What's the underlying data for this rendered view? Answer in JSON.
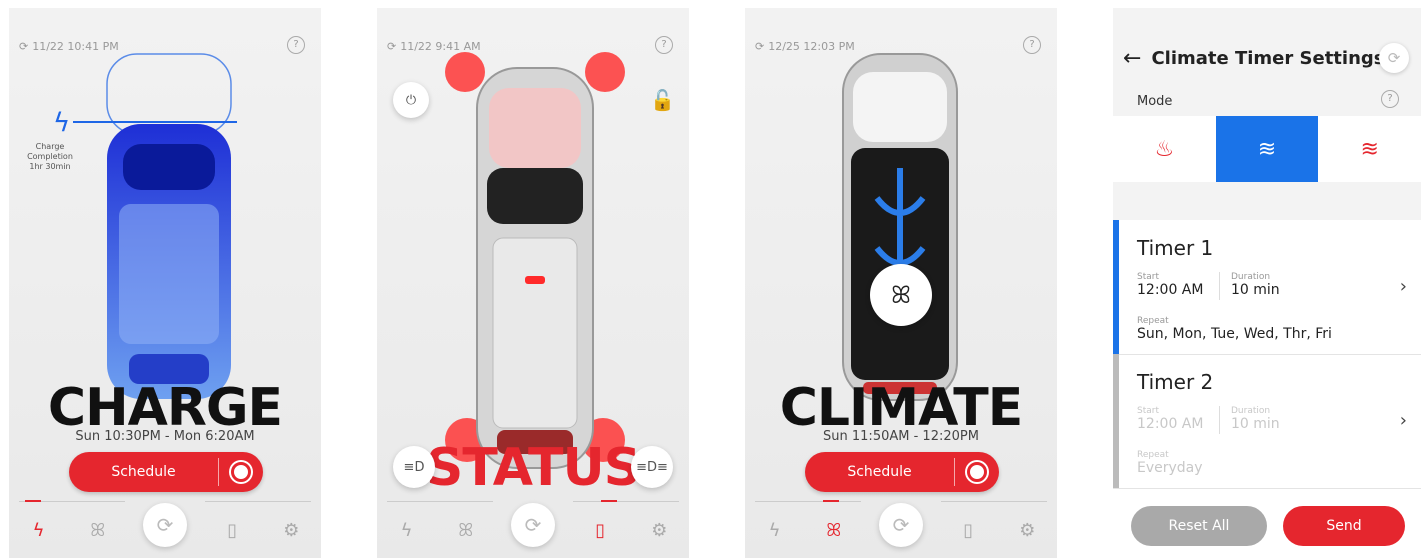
{
  "colors": {
    "accent": "#e5262e",
    "blue": "#1a73e8",
    "charge_blue": "#1e2fd6"
  },
  "screens": [
    {
      "time": "11/22  10:41 PM",
      "title": "CHARGE",
      "subtitle": "Sun 10:30PM - Mon 6:20AM",
      "button": "Schedule",
      "charge_note": [
        "Charge",
        "Completion",
        "1hr 30min"
      ]
    },
    {
      "time": "11/22  9:41 AM",
      "title": "STATUS"
    },
    {
      "time": "12/25  12:03 PM",
      "title": "CLIMATE",
      "subtitle": "Sun 11:50AM - 12:20PM",
      "button": "Schedule"
    },
    {
      "title": "Climate Timer Settings",
      "mode_label": "Mode",
      "timers": [
        {
          "name": "Timer 1",
          "start_label": "Start",
          "start": "12:00 AM",
          "duration_label": "Duration",
          "duration": "10 min",
          "repeat_label": "Repeat",
          "repeat": "Sun, Mon, Tue, Wed, Thr, Fri"
        },
        {
          "name": "Timer 2",
          "start_label": "Start",
          "start": "12:00 AM",
          "duration_label": "Duration",
          "duration": "10 min",
          "repeat_label": "Repeat",
          "repeat": "Everyday"
        }
      ],
      "reset_label": "Reset All",
      "send_label": "Send"
    }
  ],
  "icons": {
    "help": "?",
    "refresh": "⟳",
    "bolt": "ϟ",
    "fan": "ꕤ",
    "car": "car",
    "gear": "⚙",
    "back": "←",
    "chevron": "›"
  }
}
